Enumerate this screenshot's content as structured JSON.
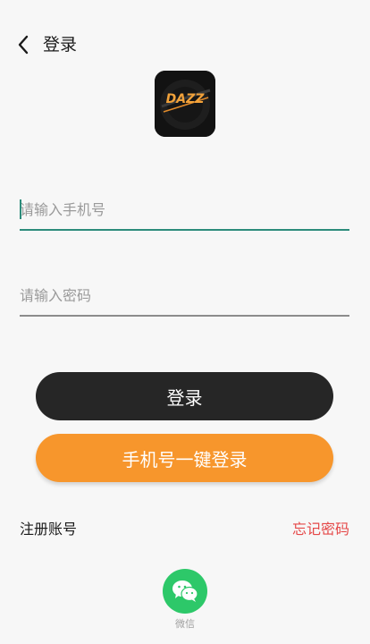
{
  "header": {
    "title": "登录"
  },
  "logo": {
    "text": "DAZZ"
  },
  "phone_field": {
    "placeholder": "请输入手机号",
    "value": ""
  },
  "password_field": {
    "placeholder": "请输入密码",
    "value": ""
  },
  "buttons": {
    "login": "登录",
    "quick_login": "手机号一键登录"
  },
  "links": {
    "register": "注册账号",
    "forgot_password": "忘记密码"
  },
  "third_party": {
    "wechat_label": "微信"
  },
  "colors": {
    "accent_teal": "#2c8c7b",
    "primary_dark": "#262626",
    "orange": "#f7962c",
    "danger": "#e54848",
    "wechat_green": "#2dc869"
  }
}
